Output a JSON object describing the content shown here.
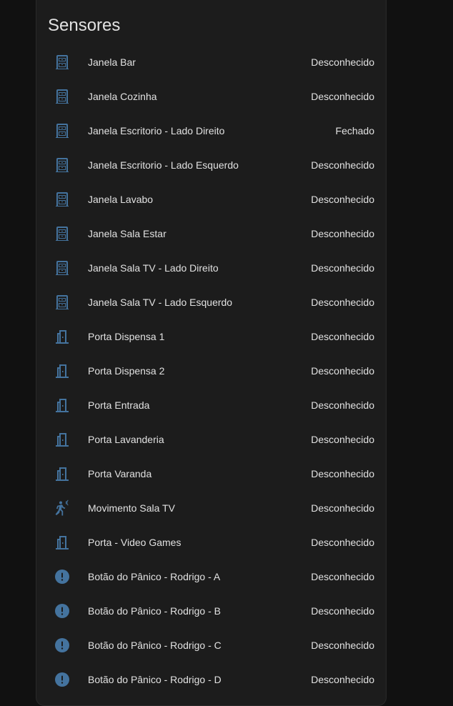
{
  "card": {
    "title": "Sensores"
  },
  "colors": {
    "icon": "#44739e",
    "text": "#e1e1e1",
    "card_bg": "#1c1c1c",
    "page_bg": "#111111"
  },
  "sensors": [
    {
      "name": "Janela Bar",
      "state": "Desconhecido",
      "icon": "window-closed-icon"
    },
    {
      "name": "Janela Cozinha",
      "state": "Desconhecido",
      "icon": "window-closed-icon"
    },
    {
      "name": "Janela Escritorio - Lado Direito",
      "state": "Fechado",
      "icon": "window-closed-icon"
    },
    {
      "name": "Janela Escritorio - Lado Esquerdo",
      "state": "Desconhecido",
      "icon": "window-closed-icon"
    },
    {
      "name": "Janela Lavabo",
      "state": "Desconhecido",
      "icon": "window-closed-icon"
    },
    {
      "name": "Janela Sala Estar",
      "state": "Desconhecido",
      "icon": "window-closed-icon"
    },
    {
      "name": "Janela Sala TV - Lado Direito",
      "state": "Desconhecido",
      "icon": "window-closed-icon"
    },
    {
      "name": "Janela Sala TV - Lado Esquerdo",
      "state": "Desconhecido",
      "icon": "window-closed-icon"
    },
    {
      "name": "Porta Dispensa 1",
      "state": "Desconhecido",
      "icon": "door-icon"
    },
    {
      "name": "Porta Dispensa 2",
      "state": "Desconhecido",
      "icon": "door-icon"
    },
    {
      "name": "Porta Entrada",
      "state": "Desconhecido",
      "icon": "door-icon"
    },
    {
      "name": "Porta Lavanderia",
      "state": "Desconhecido",
      "icon": "door-icon"
    },
    {
      "name": "Porta Varanda",
      "state": "Desconhecido",
      "icon": "door-icon"
    },
    {
      "name": "Movimento Sala TV",
      "state": "Desconhecido",
      "icon": "motion-sensor-icon"
    },
    {
      "name": "Porta - Video Games",
      "state": "Desconhecido",
      "icon": "door-icon"
    },
    {
      "name": "Botão do Pânico - Rodrigo - A",
      "state": "Desconhecido",
      "icon": "alert-circle-icon"
    },
    {
      "name": "Botão do Pânico - Rodrigo - B",
      "state": "Desconhecido",
      "icon": "alert-circle-icon"
    },
    {
      "name": "Botão do Pânico - Rodrigo - C",
      "state": "Desconhecido",
      "icon": "alert-circle-icon"
    },
    {
      "name": "Botão do Pânico - Rodrigo - D",
      "state": "Desconhecido",
      "icon": "alert-circle-icon"
    }
  ]
}
